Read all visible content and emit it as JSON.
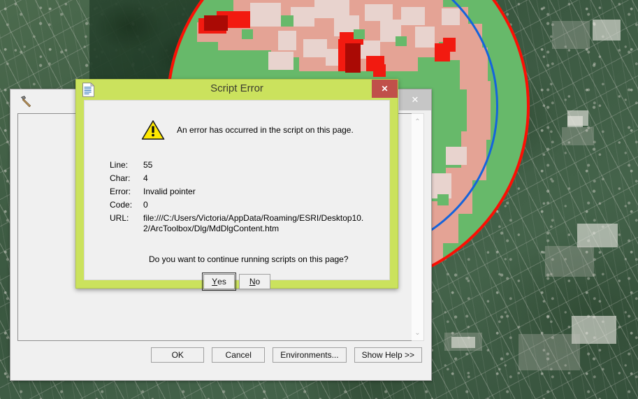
{
  "map": {
    "name": "aerial-imagery-basemap",
    "overlay_description": "raster-suitability-overlay",
    "circle_outline_color": "#fb0f05",
    "inner_arc_color": "#1464dc",
    "legend_colors": {
      "green": "#67b96a",
      "dark_green": "#1e6b2a",
      "salmon": "#e4a395",
      "light_pink": "#e8d3ce",
      "red": "#f21a10",
      "dark_red": "#aa0a05"
    }
  },
  "tool_window": {
    "icon": "hammer-icon",
    "close_label": "✕",
    "scrollbar": {
      "up_arrow": "⌃",
      "down_arrow": "⌄"
    },
    "buttons": [
      {
        "name": "ok-button",
        "label": "OK"
      },
      {
        "name": "cancel-button",
        "label": "Cancel"
      },
      {
        "name": "environments-button",
        "label": "Environments..."
      },
      {
        "name": "show-help-button",
        "label": "Show Help >>"
      }
    ]
  },
  "script_error": {
    "icon": "document-icon",
    "title": "Script Error",
    "close_label": "✕",
    "warning_icon": "warning-triangle-icon",
    "message": "An error has occurred in the script on this page.",
    "fields": [
      {
        "label": "Line:",
        "value": "55"
      },
      {
        "label": "Char:",
        "value": "4"
      },
      {
        "label": "Error:",
        "value": "Invalid pointer"
      },
      {
        "label": "Code:",
        "value": "0"
      }
    ],
    "url_label": "URL:",
    "url_value": "file:///C:/Users/Victoria/AppData/Roaming/ESRI/Desktop10.2/ArcToolbox/Dlg/MdDlgContent.htm",
    "question": "Do you want to continue running scripts on this page?",
    "buttons": [
      {
        "name": "yes-button",
        "accel": "Y",
        "rest": "es",
        "default": true
      },
      {
        "name": "no-button",
        "accel": "N",
        "rest": "o",
        "default": false
      }
    ],
    "titlebar_color": "#cbe25d",
    "close_button_color": "#c0504a"
  }
}
